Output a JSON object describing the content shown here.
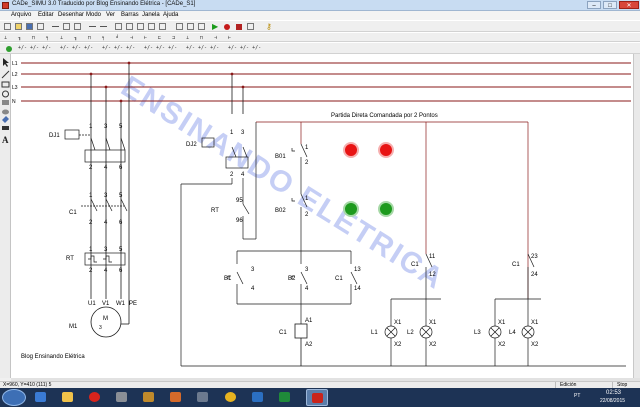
{
  "window": {
    "title": "CADe_SIMU 3.0 Traducido por Blog Ensinando Elétrica - [CADe_S1]",
    "controls": {
      "minimize": "–",
      "maximize": "□",
      "close": "✕"
    }
  },
  "menu": [
    "Arquivo",
    "Editar",
    "Desenhar",
    "Modo",
    "Ver",
    "Barras",
    "Janela",
    "Ajuda"
  ],
  "toolbar": {
    "tools": [
      "new",
      "open",
      "save",
      "print",
      "cut",
      "copy",
      "paste",
      "undo",
      "redo",
      "zoom-in",
      "zoom-out",
      "zoom-fit",
      "simulate-play",
      "record",
      "stop",
      "pause",
      "help-key"
    ],
    "symbol_glyphs": [
      "⊥",
      "╖",
      "⊓",
      "╕",
      "⊥",
      "╖",
      "⊓",
      "╕",
      "╛",
      "⊣",
      "⊢",
      "⊏",
      "⊐",
      "⊥",
      "⊓",
      "⊣",
      "⊢"
    ]
  },
  "palette": {
    "glyph": "+/- +/- +/-"
  },
  "sidebar_tools": [
    "pointer-icon",
    "line-icon",
    "rectangle-icon",
    "circle-icon",
    "text-icon"
  ],
  "diagram": {
    "title": "Partida Direta Comandada por 2  Pontos",
    "watermark": "ENSINANDO ELÉTRICA",
    "footer": "Blog Ensinando Elétrica",
    "bus_labels": [
      "L1",
      "L2",
      "L3",
      "N"
    ],
    "labels": {
      "dj1": "DJ1",
      "dj2": "DJ2",
      "c1": "C1",
      "rt": "RT",
      "m1": "M1",
      "motor_m": "M",
      "motor_3": "3",
      "u1": "U1",
      "v1": "V1",
      "w1": "W1",
      "pe": "PE",
      "b01": "B01",
      "b02": "B02",
      "b1": "B1",
      "b2": "B2",
      "c1_aux": "C1",
      "c1_coil": "C1",
      "l1": "L1",
      "l2": "L2",
      "l3": "L3",
      "l4": "L4",
      "a1": "A1",
      "a2": "A2",
      "x1": "X1",
      "x2": "X2",
      "n1": "1",
      "n2": "2",
      "n3": "3",
      "n4": "4",
      "n5": "5",
      "n6": "6",
      "n13": "13",
      "n14": "14",
      "n11": "11",
      "n12": "12",
      "n23": "23",
      "n24": "24",
      "n95": "95",
      "n96": "96"
    },
    "colors": {
      "line": "#8a1a1a",
      "wire": "#1a1a1a",
      "lamp_red": "#e81414",
      "lamp_green": "#1d9a1d",
      "watermark": "#b7c2f2"
    }
  },
  "status": {
    "coords": "X=960, Y=410 (111) 5",
    "mode": "Edición",
    "state": "Stop"
  },
  "taskbar": {
    "apps": [
      "start-orb",
      "ie-icon",
      "folder-icon",
      "opera-icon",
      "camera-icon",
      "video-icon",
      "chrome-icon",
      "wps-icon",
      "excel-icon",
      "cadesimu-icon"
    ],
    "lang": "PT",
    "time": "02:53",
    "date": "22/08/2015"
  }
}
